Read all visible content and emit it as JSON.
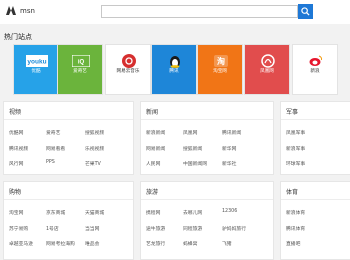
{
  "header": {
    "logo_text": "msn",
    "search": {
      "placeholder": "",
      "value": ""
    }
  },
  "hot_sites": {
    "title": "热门站点",
    "tiles": [
      {
        "label": "优酷",
        "bg": "#26a2e8",
        "logo": "youku"
      },
      {
        "label": "爱奇艺",
        "bg": "#6bb43c",
        "logo": "iqiyi"
      },
      {
        "label": "网易云音乐",
        "bg": "#ffffff",
        "logo": "netease-music"
      },
      {
        "label": "腾讯",
        "bg": "#1e86d8",
        "logo": "tencent"
      },
      {
        "label": "淘宝网",
        "bg": "#f17516",
        "logo": "taobao"
      },
      {
        "label": "凤凰网",
        "bg": "#e14d4d",
        "logo": "ifeng"
      },
      {
        "label": "新浪",
        "bg": "#ffffff",
        "logo": "sina"
      }
    ]
  },
  "sections": [
    {
      "title": "视频",
      "columns": [
        [
          "优酷网",
          "腾讯视频",
          "风行网"
        ],
        [
          "爱奇艺",
          "芒果TV",
          "咪咕视频"
        ],
        [
          "搜狐视频",
          "乐视视频",
          "哔哩哔哩"
        ]
      ],
      "links": [
        [
          "优酷网",
          "爱奇艺",
          "搜狐视频"
        ],
        [
          "腾讯视频",
          "网易看看",
          "乐视视频"
        ],
        [
          "风行网",
          "PPS",
          "芒果TV"
        ]
      ]
    },
    {
      "title": "新闻",
      "links": [
        [
          "新浪新闻",
          "凤凰网",
          "腾讯新闻"
        ],
        [
          "网易新闻",
          "搜狐新闻",
          "新华网"
        ],
        [
          "人民网",
          "中国新闻网",
          "新华社"
        ]
      ]
    },
    {
      "title": "军事",
      "links": [
        [
          "凤凰军事"
        ],
        [
          "新浪军事"
        ],
        [
          "环球军事"
        ]
      ]
    },
    {
      "title": "购物",
      "links": [
        [
          "淘宝网",
          "京东商城",
          "天猫商城"
        ],
        [
          "苏宁易购",
          "1号店",
          "当当网"
        ],
        [
          "卓越亚马逊",
          "网易考拉海购",
          "唯品会"
        ]
      ]
    },
    {
      "title": "旅游",
      "links": [
        [
          "携程网",
          "去哪儿网",
          "12306"
        ],
        [
          "途牛旅游",
          "同程旅游",
          "驴妈妈旅行"
        ],
        [
          "艺龙旅行",
          "蚂蜂窝",
          "飞猪"
        ]
      ]
    },
    {
      "title": "体育",
      "links": [
        [
          "新浪体育"
        ],
        [
          "腾讯体育"
        ],
        [
          "直播吧"
        ]
      ]
    }
  ]
}
